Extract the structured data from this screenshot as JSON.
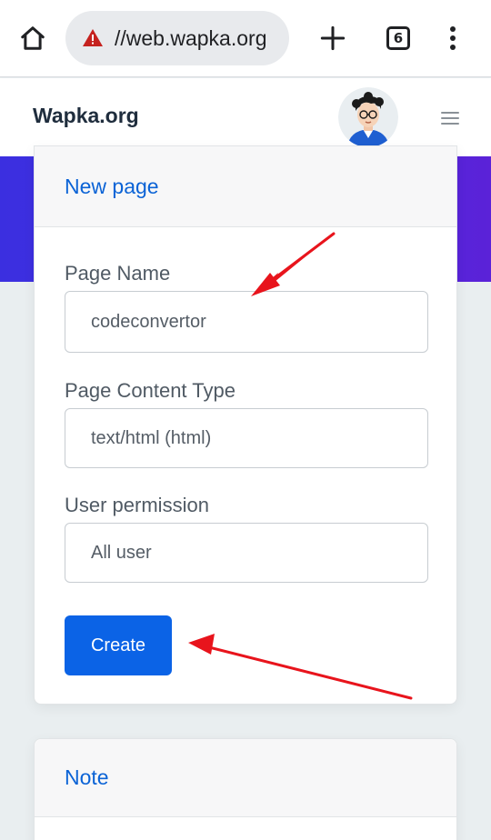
{
  "browser": {
    "url": "//web.wapka.org",
    "tab_count": "6",
    "icons": {
      "home": "home-icon",
      "security_warning": "warning-triangle-icon",
      "new_tab": "plus-icon",
      "menu": "more-vert-icon"
    }
  },
  "site": {
    "brand": "Wapka.org",
    "avatar": "user-avatar",
    "menu_icon": "hamburger-icon"
  },
  "new_page_form": {
    "title": "New page",
    "page_name_label": "Page Name",
    "page_name_value": "codeconvertor",
    "content_type_label": "Page Content Type",
    "content_type_value": "text/html (html)",
    "permission_label": "User permission",
    "permission_value": "All user",
    "create_button": "Create"
  },
  "note_card": {
    "title": "Note"
  },
  "colors": {
    "primary": "#0b63e6",
    "link": "#0b63d6",
    "hero_start": "#3b2fe0",
    "hero_end": "#5b22d8",
    "annotation_arrow": "#e8141c"
  }
}
